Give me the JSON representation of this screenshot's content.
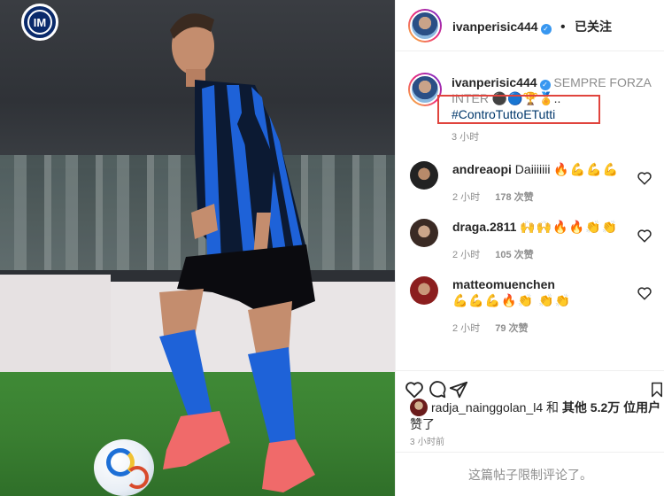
{
  "post": {
    "logo_text": "IM",
    "header": {
      "username": "ivanperisic444",
      "separator": "•",
      "follow_label": "已关注"
    },
    "caption": {
      "username": "ivanperisic444",
      "text": "SEMPRE FORZA INTER",
      "emojis": "⚫🔵🏆🏅..",
      "hashtag": "#ControTuttoETutti",
      "time": "3 小时"
    },
    "comments": [
      {
        "username": "andreaopi",
        "text": "Daiiiiiii",
        "emojis": "🔥💪💪💪",
        "time": "2 小时",
        "likes": "178 次赞"
      },
      {
        "username": "draga.2811",
        "text": "",
        "emojis": "🙌🙌🔥🔥👏👏",
        "time": "2 小时",
        "likes": "105 次赞"
      },
      {
        "username": "matteomuenchen",
        "text": "",
        "emojis": "💪💪💪🔥👏 👏👏",
        "time": "2 小时",
        "likes": "79 次赞"
      }
    ],
    "likes_line": {
      "user": "radja_nainggolan_l4",
      "and": "和",
      "others": "其他 5.2万 位用户",
      "liked": "赞了"
    },
    "post_time": "3 小时前",
    "comments_disabled": "这篇帖子限制评论了。"
  },
  "colors": {
    "verified": "#3897f0",
    "highlight_box": "#e0443d",
    "hashtag": "#00376b",
    "muted": "#8e8e8e"
  }
}
